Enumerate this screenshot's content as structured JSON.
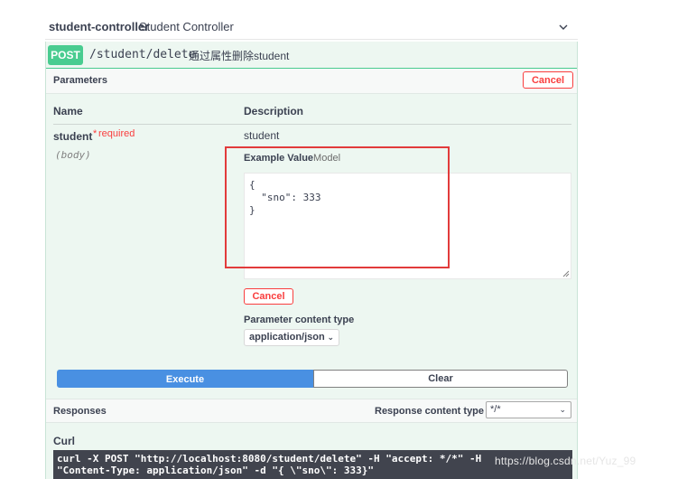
{
  "controller": {
    "name": "student-controller",
    "description": "Student Controller",
    "chevron_icon": "chevron-down-icon"
  },
  "operation": {
    "method": "POST",
    "path": "/student/delete",
    "summary": "通过属性删除student",
    "color": "#49cc90"
  },
  "parameters": {
    "title": "Parameters",
    "cancel_label": "Cancel",
    "col_name": "Name",
    "col_description": "Description",
    "items": [
      {
        "name": "student",
        "required_star": "*",
        "required": "required",
        "in": "(body)",
        "description": "student",
        "tab_example": "Example Value",
        "tab_model": "Model",
        "body_value": "{\n  \"sno\": 333\n}"
      }
    ],
    "body_cancel_label": "Cancel",
    "content_type_label": "Parameter content type",
    "content_type_value": "application/json"
  },
  "actions": {
    "execute_label": "Execute",
    "clear_label": "Clear",
    "execute_color": "#4990e2"
  },
  "responses": {
    "title": "Responses",
    "content_type_label": "Response content type",
    "content_type_value": "*/*"
  },
  "curl": {
    "title": "Curl",
    "command": "curl -X POST \"http://localhost:8080/student/delete\" -H \"accept: */*\" -H\n\"Content-Type: application/json\" -d \"{ \\\"sno\\\": 333}\""
  },
  "watermark": "https://blog.csdn.net/Yuz_99",
  "highlight_color": "#e23b3b"
}
